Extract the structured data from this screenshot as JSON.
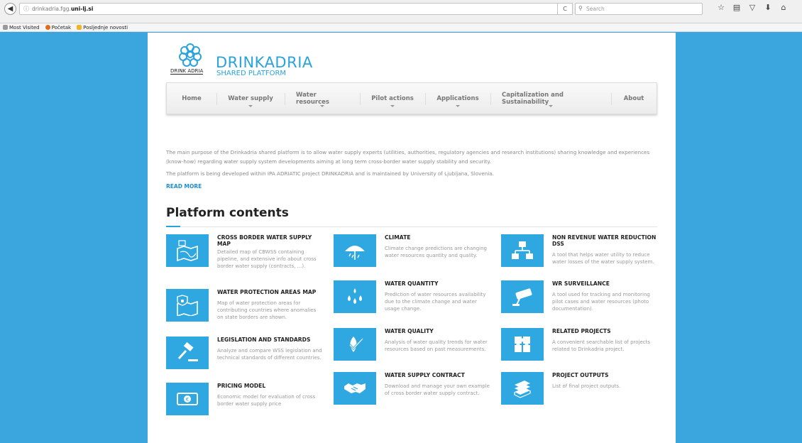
{
  "browser": {
    "url_prefix": "drinkadria.fgg.",
    "url_domain": "uni-lj.si",
    "info_icon": "ⓘ",
    "search_placeholder": "Search",
    "bookmarks": [
      {
        "label": "Most Visited",
        "color": "#9a9a9a"
      },
      {
        "label": "Početak",
        "color": "#e06b1c"
      },
      {
        "label": "Posljednje novosti",
        "color": "#f0b429"
      }
    ]
  },
  "header": {
    "logo_caption": "DRINK ADRIA",
    "brand_title": "DRINKADRIA",
    "brand_subtitle": "SHARED PLATFORM"
  },
  "nav": {
    "items": [
      {
        "label": "Home",
        "has_dropdown": false
      },
      {
        "label": "Water supply",
        "has_dropdown": true
      },
      {
        "label": "Water resources",
        "has_dropdown": true
      },
      {
        "label": "Pilot actions",
        "has_dropdown": true
      },
      {
        "label": "Applications",
        "has_dropdown": true
      },
      {
        "label": "Capitalization and Sustainability",
        "has_dropdown": true
      },
      {
        "label": "About",
        "has_dropdown": false
      }
    ]
  },
  "intro": {
    "paragraph1": "The main purpose of the Drinkadria shared platform is to allow water supply experts (utilities, authorities, regulatory agencies and research institutions) sharing knowledge and experiences (know-how) regarding water supply system developments aiming at long term cross-border water supply stability and security.",
    "paragraph2": "The platform is being developed within IPA ADRIATIC project DRINKADRIA and is maintained by University of Ljubljana, Slovenia.",
    "read_more": "READ MORE"
  },
  "contents": {
    "title": "Platform contents",
    "accent_color": "#2fa7e0",
    "cards": [
      {
        "title": "CROSS BORDER WATER SUPPLY MAP",
        "desc": "Detailed map of CBWSS containing pipeline, and extensive info about cross border water supply (contracts, ...).",
        "icon": "map-icon"
      },
      {
        "title": "WATER PROTECTION AREAS MAP",
        "desc": "Map of water protection areas for contributing countries where anomalies on state borders are shown.",
        "icon": "shield-map-icon"
      },
      {
        "title": "LEGISLATION AND STANDARDS",
        "desc": "Analyze and compare WSS legislation and technical standards of different countries.",
        "icon": "gavel-icon"
      },
      {
        "title": "PRICING MODEL",
        "desc": "Economic model for evaluation of cross border water supply price",
        "icon": "banknote-icon"
      },
      {
        "title": "CLIMATE",
        "desc": "Climate change predictions are changing water resources quantity and quality.",
        "icon": "umbrella-icon"
      },
      {
        "title": "WATER QUANTITY",
        "desc": "Prediction of water resources availability due to the climate change and water usage change.",
        "icon": "drops-icon"
      },
      {
        "title": "WATER QUALITY",
        "desc": "Analysis of water quality trends for water resources based on past measurements.",
        "icon": "drop-check-icon"
      },
      {
        "title": "WATER SUPPLY CONTRACT",
        "desc": "Download and manage your own example of cross border water supply contract.",
        "icon": "handshake-icon"
      },
      {
        "title": "NON REVENUE WATER REDUCTION DSS",
        "desc": "A tool that helps water utility to reduce water losses of the water supply system.",
        "icon": "network-icon"
      },
      {
        "title": "WR SURVEILLANCE",
        "desc": "A tool used for tracking and monitoring pilot cases and water resources (photo documentation).",
        "icon": "camera-icon"
      },
      {
        "title": "RELATED PROJECTS",
        "desc": "A convenient searchable list of projects related to Drinkadria project.",
        "icon": "puzzle-icon"
      },
      {
        "title": "PROJECT OUTPUTS",
        "desc": "List of final project outputs.",
        "icon": "books-icon"
      }
    ]
  }
}
